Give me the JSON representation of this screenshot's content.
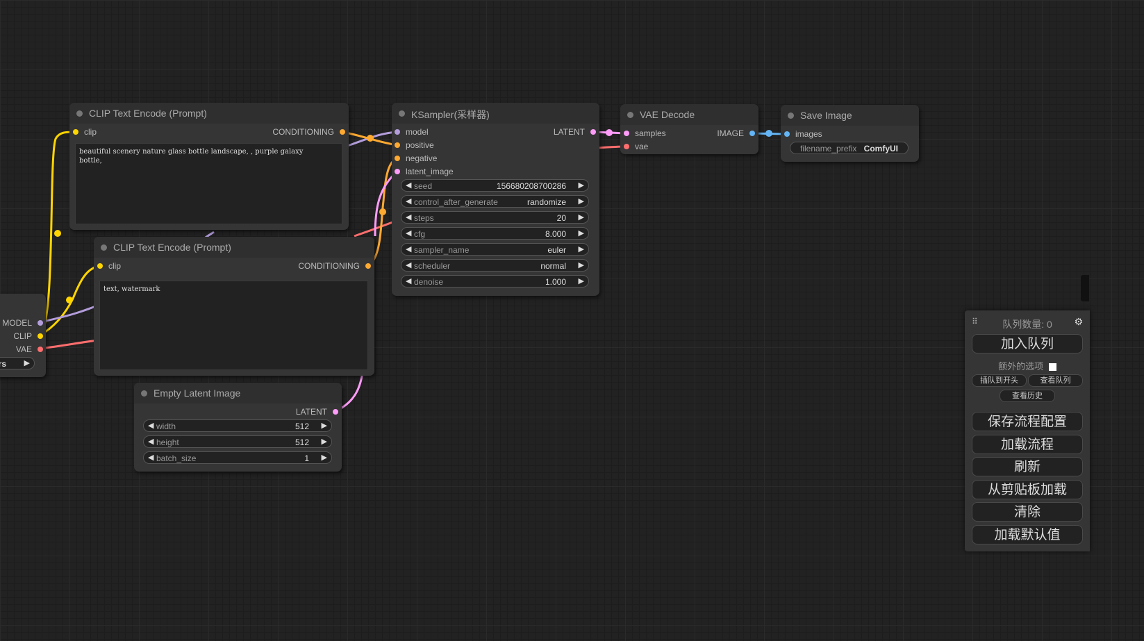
{
  "nodes": {
    "clip_pos": {
      "title": "CLIP Text Encode (Prompt)",
      "input_clip": "clip",
      "output": "CONDITIONING",
      "text": "beautiful scenery nature glass bottle landscape, , purple galaxy\nbottle,"
    },
    "clip_neg": {
      "title": "CLIP Text Encode (Prompt)",
      "input_clip": "clip",
      "output": "CONDITIONING",
      "text": "text, watermark"
    },
    "ksampler": {
      "title": "KSampler(采样器)",
      "inputs": [
        "model",
        "positive",
        "negative",
        "latent_image"
      ],
      "output": "LATENT",
      "widgets": [
        {
          "name": "seed",
          "value": "156680208700286"
        },
        {
          "name": "control_after_generate",
          "value": "randomize"
        },
        {
          "name": "steps",
          "value": "20"
        },
        {
          "name": "cfg",
          "value": "8.000"
        },
        {
          "name": "sampler_name",
          "value": "euler"
        },
        {
          "name": "scheduler",
          "value": "normal"
        },
        {
          "name": "denoise",
          "value": "1.000"
        }
      ]
    },
    "vae_decode": {
      "title": "VAE Decode",
      "inputs": [
        "samples",
        "vae"
      ],
      "output": "IMAGE"
    },
    "save_image": {
      "title": "Save Image",
      "input": "images",
      "widget": {
        "name": "filename_prefix",
        "value": "ComfyUI"
      }
    },
    "empty_latent": {
      "title": "Empty Latent Image",
      "output": "LATENT",
      "widgets": [
        {
          "name": "width",
          "value": "512"
        },
        {
          "name": "height",
          "value": "512"
        },
        {
          "name": "batch_size",
          "value": "1"
        }
      ]
    },
    "checkpoint": {
      "outputs": [
        "MODEL",
        "CLIP",
        "VAE"
      ],
      "widget_text": "sors"
    }
  },
  "menu": {
    "queue_size": "队列数量: 0",
    "queue_prompt": "加入队列",
    "extra_options": "额外的选项",
    "queue_front": "插队到开头",
    "view_queue": "查看队列",
    "view_history": "查看历史",
    "save": "保存流程配置",
    "load": "加载流程",
    "refresh": "刷新",
    "clipspace": "从剪贴板加载",
    "clear": "清除",
    "load_default": "加载默认值"
  },
  "colors": {
    "clip": "#FFD500",
    "conditioning": "#FFA931",
    "model": "#B39DDB",
    "latent": "#FF9CF9",
    "vae": "#FF6E6E",
    "image": "#64B5F6"
  }
}
